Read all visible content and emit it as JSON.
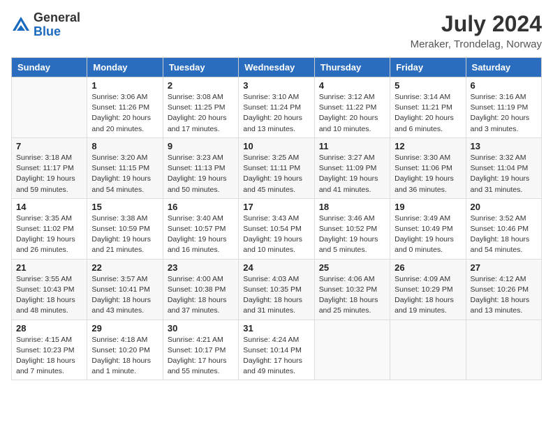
{
  "header": {
    "logo_general": "General",
    "logo_blue": "Blue",
    "month_year": "July 2024",
    "location": "Meraker, Trondelag, Norway"
  },
  "columns": [
    "Sunday",
    "Monday",
    "Tuesday",
    "Wednesday",
    "Thursday",
    "Friday",
    "Saturday"
  ],
  "weeks": [
    [
      {
        "day": "",
        "info": ""
      },
      {
        "day": "1",
        "info": "Sunrise: 3:06 AM\nSunset: 11:26 PM\nDaylight: 20 hours\nand 20 minutes."
      },
      {
        "day": "2",
        "info": "Sunrise: 3:08 AM\nSunset: 11:25 PM\nDaylight: 20 hours\nand 17 minutes."
      },
      {
        "day": "3",
        "info": "Sunrise: 3:10 AM\nSunset: 11:24 PM\nDaylight: 20 hours\nand 13 minutes."
      },
      {
        "day": "4",
        "info": "Sunrise: 3:12 AM\nSunset: 11:22 PM\nDaylight: 20 hours\nand 10 minutes."
      },
      {
        "day": "5",
        "info": "Sunrise: 3:14 AM\nSunset: 11:21 PM\nDaylight: 20 hours\nand 6 minutes."
      },
      {
        "day": "6",
        "info": "Sunrise: 3:16 AM\nSunset: 11:19 PM\nDaylight: 20 hours\nand 3 minutes."
      }
    ],
    [
      {
        "day": "7",
        "info": "Sunrise: 3:18 AM\nSunset: 11:17 PM\nDaylight: 19 hours\nand 59 minutes."
      },
      {
        "day": "8",
        "info": "Sunrise: 3:20 AM\nSunset: 11:15 PM\nDaylight: 19 hours\nand 54 minutes."
      },
      {
        "day": "9",
        "info": "Sunrise: 3:23 AM\nSunset: 11:13 PM\nDaylight: 19 hours\nand 50 minutes."
      },
      {
        "day": "10",
        "info": "Sunrise: 3:25 AM\nSunset: 11:11 PM\nDaylight: 19 hours\nand 45 minutes."
      },
      {
        "day": "11",
        "info": "Sunrise: 3:27 AM\nSunset: 11:09 PM\nDaylight: 19 hours\nand 41 minutes."
      },
      {
        "day": "12",
        "info": "Sunrise: 3:30 AM\nSunset: 11:06 PM\nDaylight: 19 hours\nand 36 minutes."
      },
      {
        "day": "13",
        "info": "Sunrise: 3:32 AM\nSunset: 11:04 PM\nDaylight: 19 hours\nand 31 minutes."
      }
    ],
    [
      {
        "day": "14",
        "info": "Sunrise: 3:35 AM\nSunset: 11:02 PM\nDaylight: 19 hours\nand 26 minutes."
      },
      {
        "day": "15",
        "info": "Sunrise: 3:38 AM\nSunset: 10:59 PM\nDaylight: 19 hours\nand 21 minutes."
      },
      {
        "day": "16",
        "info": "Sunrise: 3:40 AM\nSunset: 10:57 PM\nDaylight: 19 hours\nand 16 minutes."
      },
      {
        "day": "17",
        "info": "Sunrise: 3:43 AM\nSunset: 10:54 PM\nDaylight: 19 hours\nand 10 minutes."
      },
      {
        "day": "18",
        "info": "Sunrise: 3:46 AM\nSunset: 10:52 PM\nDaylight: 19 hours\nand 5 minutes."
      },
      {
        "day": "19",
        "info": "Sunrise: 3:49 AM\nSunset: 10:49 PM\nDaylight: 19 hours\nand 0 minutes."
      },
      {
        "day": "20",
        "info": "Sunrise: 3:52 AM\nSunset: 10:46 PM\nDaylight: 18 hours\nand 54 minutes."
      }
    ],
    [
      {
        "day": "21",
        "info": "Sunrise: 3:55 AM\nSunset: 10:43 PM\nDaylight: 18 hours\nand 48 minutes."
      },
      {
        "day": "22",
        "info": "Sunrise: 3:57 AM\nSunset: 10:41 PM\nDaylight: 18 hours\nand 43 minutes."
      },
      {
        "day": "23",
        "info": "Sunrise: 4:00 AM\nSunset: 10:38 PM\nDaylight: 18 hours\nand 37 minutes."
      },
      {
        "day": "24",
        "info": "Sunrise: 4:03 AM\nSunset: 10:35 PM\nDaylight: 18 hours\nand 31 minutes."
      },
      {
        "day": "25",
        "info": "Sunrise: 4:06 AM\nSunset: 10:32 PM\nDaylight: 18 hours\nand 25 minutes."
      },
      {
        "day": "26",
        "info": "Sunrise: 4:09 AM\nSunset: 10:29 PM\nDaylight: 18 hours\nand 19 minutes."
      },
      {
        "day": "27",
        "info": "Sunrise: 4:12 AM\nSunset: 10:26 PM\nDaylight: 18 hours\nand 13 minutes."
      }
    ],
    [
      {
        "day": "28",
        "info": "Sunrise: 4:15 AM\nSunset: 10:23 PM\nDaylight: 18 hours\nand 7 minutes."
      },
      {
        "day": "29",
        "info": "Sunrise: 4:18 AM\nSunset: 10:20 PM\nDaylight: 18 hours\nand 1 minute."
      },
      {
        "day": "30",
        "info": "Sunrise: 4:21 AM\nSunset: 10:17 PM\nDaylight: 17 hours\nand 55 minutes."
      },
      {
        "day": "31",
        "info": "Sunrise: 4:24 AM\nSunset: 10:14 PM\nDaylight: 17 hours\nand 49 minutes."
      },
      {
        "day": "",
        "info": ""
      },
      {
        "day": "",
        "info": ""
      },
      {
        "day": "",
        "info": ""
      }
    ]
  ]
}
